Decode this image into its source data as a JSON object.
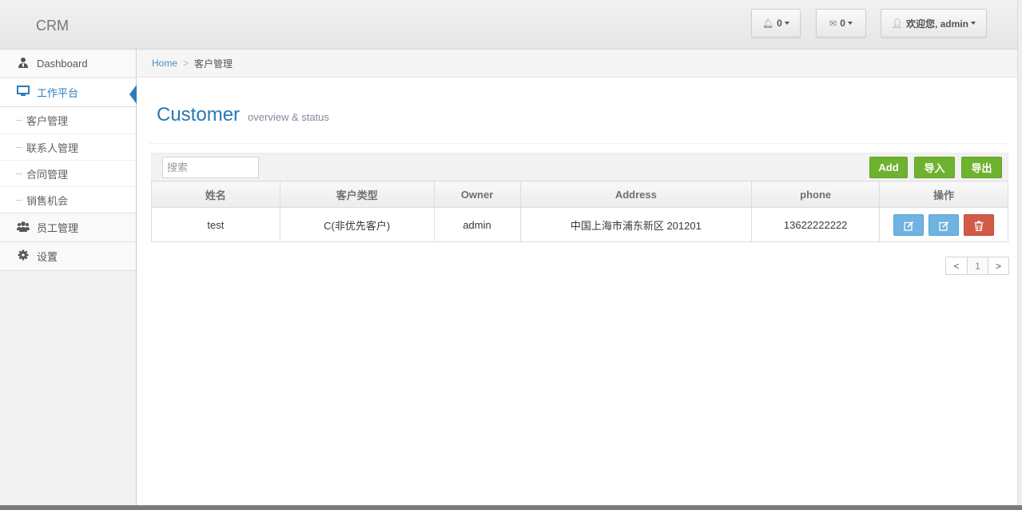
{
  "brand": "CRM",
  "navbar": {
    "notifications": {
      "icon": "bell-icon",
      "count": "0"
    },
    "messages": {
      "icon": "envelope-icon",
      "count": "0"
    },
    "user": {
      "icon": "user-icon",
      "label": "欢迎您, admin"
    }
  },
  "sidebar": {
    "items": [
      {
        "label": "Dashboard",
        "icon": "user-tie-icon"
      },
      {
        "label": "工作平台",
        "icon": "desktop-icon",
        "active": true,
        "children": [
          "客户管理",
          "联系人管理",
          "合同管理",
          "销售机会"
        ]
      },
      {
        "label": "员工管理",
        "icon": "users-icon"
      },
      {
        "label": "设置",
        "icon": "gear-icon"
      }
    ]
  },
  "breadcrumb": {
    "home": "Home",
    "current": "客户管理"
  },
  "page": {
    "title": "Customer",
    "subtitle": "overview & status"
  },
  "toolbar": {
    "search_placeholder": "搜索",
    "add_label": "Add",
    "import_label": "导入",
    "export_label": "导出"
  },
  "table": {
    "headers": [
      "姓名",
      "客户类型",
      "Owner",
      "Address",
      "phone",
      "操作"
    ],
    "rows": [
      {
        "name": "test",
        "type": "C(非优先客户)",
        "owner": "admin",
        "address": "中国上海市浦东新区 201201",
        "phone": "13622222222"
      }
    ]
  },
  "pagination": {
    "prev": "<",
    "page": "1",
    "next": ">"
  },
  "colors": {
    "accent": "#2679b5",
    "green": "#6fb22f",
    "blue_btn": "#6fb3e0",
    "red_btn": "#d15b47"
  }
}
